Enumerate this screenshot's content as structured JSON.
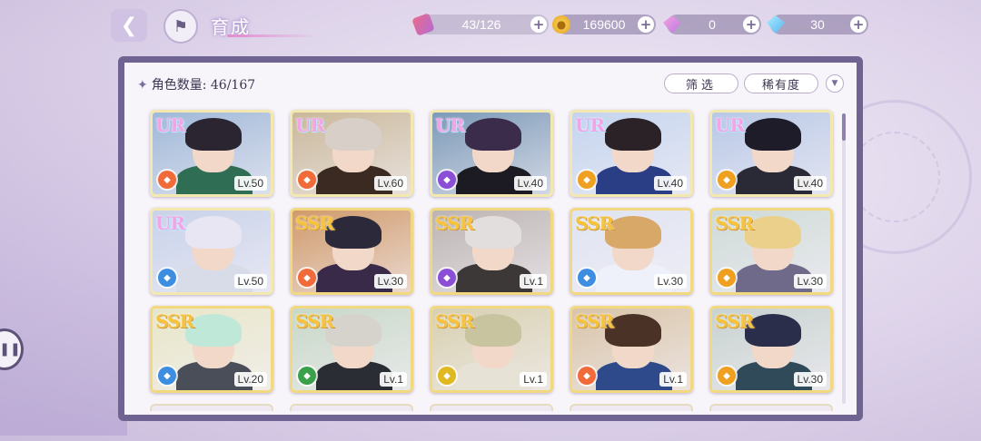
{
  "header": {
    "back_icon": "back-arrow-icon",
    "home_icon": "castle-icon",
    "title": "育成"
  },
  "resources": [
    {
      "name": "candy",
      "icon": "candy-icon",
      "value": "43/126"
    },
    {
      "name": "gold",
      "icon": "coin-icon",
      "value": "169600"
    },
    {
      "name": "pink-gem",
      "icon": "pink-diamond-icon",
      "value": "0"
    },
    {
      "name": "blue-gem",
      "icon": "blue-diamond-icon",
      "value": "30"
    }
  ],
  "panel": {
    "count_label": "角色数量: 46/167",
    "filter_label": "筛选",
    "rarity_label": "稀有度",
    "sort_icon": "sort-down-icon"
  },
  "cards": [
    {
      "rarity": "UR",
      "level": "Lv.50",
      "element_color": "#f06a3a",
      "hair": "#2a2530",
      "outfit": "#2f6e55",
      "bg": "#9fb8d8"
    },
    {
      "rarity": "UR",
      "level": "Lv.60",
      "element_color": "#f06a3a",
      "hair": "#d8d0c8",
      "outfit": "#3a2a22",
      "bg": "#c9b89a"
    },
    {
      "rarity": "UR",
      "level": "Lv.40",
      "element_color": "#8a4fd6",
      "hair": "#3a2c4a",
      "outfit": "#1c1a22",
      "bg": "#7c9ab8"
    },
    {
      "rarity": "UR",
      "level": "Lv.40",
      "element_color": "#f0a020",
      "hair": "#2a2226",
      "outfit": "#2a3e86",
      "bg": "#c4d4ee"
    },
    {
      "rarity": "UR",
      "level": "Lv.40",
      "element_color": "#f0a020",
      "hair": "#1e1c28",
      "outfit": "#2a2a36",
      "bg": "#b8c8e6"
    },
    {
      "rarity": "UR",
      "level": "Lv.50",
      "element_color": "#3d8ee0",
      "hair": "#e8e6f2",
      "outfit": "#d8dce8",
      "bg": "#c8d2ea"
    },
    {
      "rarity": "SSR",
      "level": "Lv.30",
      "element_color": "#f06a3a",
      "hair": "#2c2a3a",
      "outfit": "#3a2a4a",
      "bg": "#d09a6a"
    },
    {
      "rarity": "SSR",
      "level": "Lv.1",
      "element_color": "#8a4fd6",
      "hair": "#e2dede",
      "outfit": "#3c3838",
      "bg": "#bcb4b2"
    },
    {
      "rarity": "SSR",
      "level": "Lv.30",
      "element_color": "#3d8ee0",
      "hair": "#d8a868",
      "outfit": "#eef0fa",
      "bg": "#dfe4f2"
    },
    {
      "rarity": "SSR",
      "level": "Lv.30",
      "element_color": "#f0a020",
      "hair": "#ead08a",
      "outfit": "#6f6a8a",
      "bg": "#cfdad8"
    },
    {
      "rarity": "SSR",
      "level": "Lv.20",
      "element_color": "#3d8ee0",
      "hair": "#bfe8d8",
      "outfit": "#4a4e58",
      "bg": "#e8e6c8"
    },
    {
      "rarity": "SSR",
      "level": "Lv.1",
      "element_color": "#3aa04a",
      "hair": "#d6d2cc",
      "outfit": "#2a2e34",
      "bg": "#c8d8c8"
    },
    {
      "rarity": "SSR",
      "level": "Lv.1",
      "element_color": "#e0b820",
      "hair": "#c8c4a0",
      "outfit": "#e6e2d6",
      "bg": "#d8d0b0"
    },
    {
      "rarity": "SSR",
      "level": "Lv.1",
      "element_color": "#f06a3a",
      "hair": "#4a3226",
      "outfit": "#2f4a8a",
      "bg": "#d8c4a8"
    },
    {
      "rarity": "SSR",
      "level": "Lv.30",
      "element_color": "#f0a020",
      "hair": "#2a2e4a",
      "outfit": "#304a5a",
      "bg": "#c8d2d0"
    }
  ]
}
